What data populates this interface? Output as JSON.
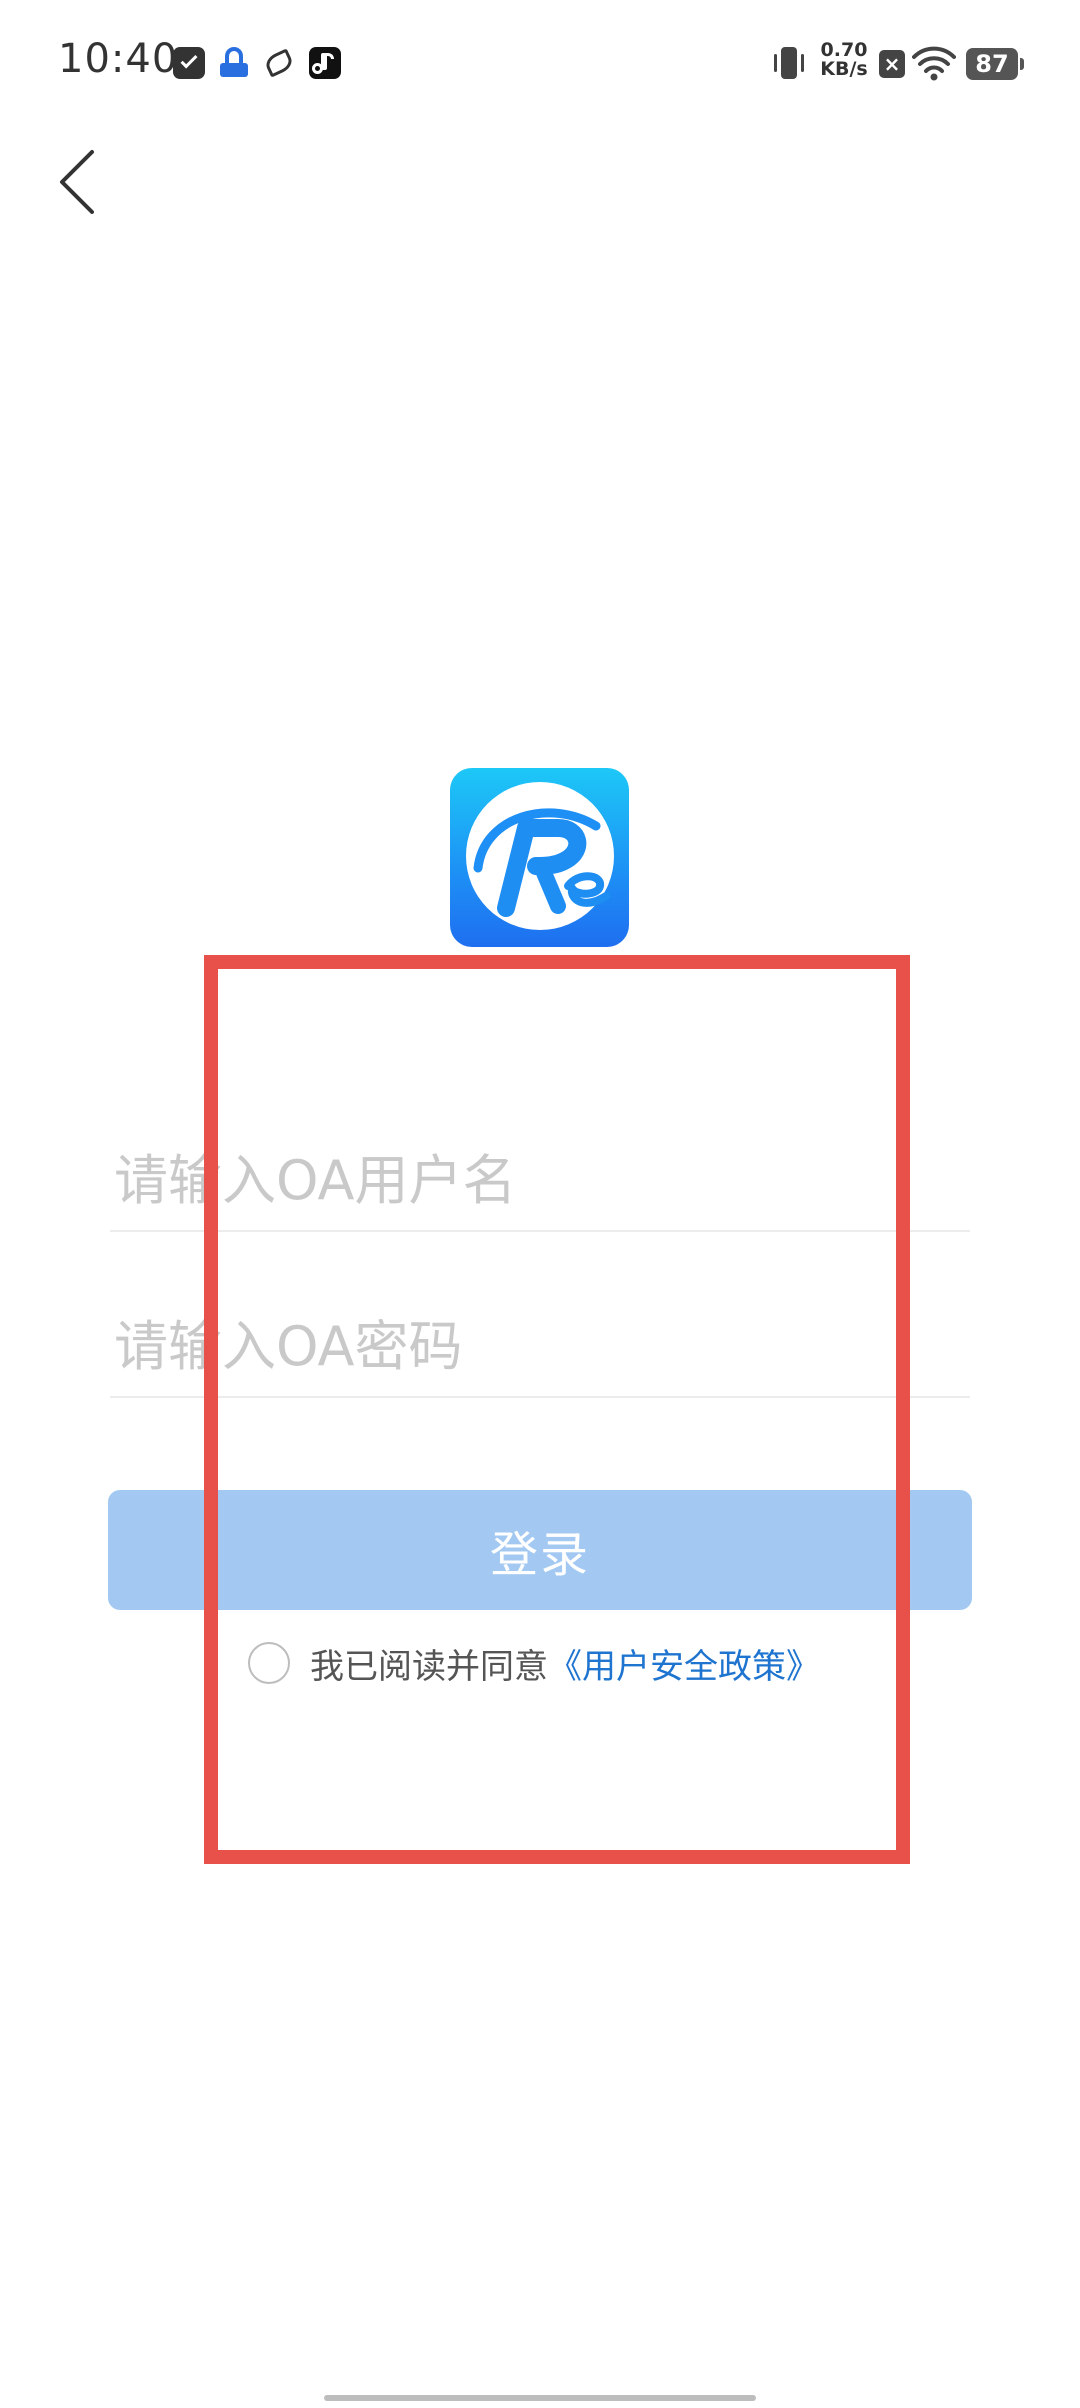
{
  "status_bar": {
    "time": "10:40",
    "net_speed_value": "0.70",
    "net_speed_unit": "KB/s",
    "notification_badge": "×",
    "battery_level": "87"
  },
  "icons": {
    "back": "chevron-left-icon",
    "logo": "re-app-logo"
  },
  "login_form": {
    "username_placeholder": "请输入OA用户名",
    "password_placeholder": "请输入OA密码",
    "login_label": "登录",
    "agreement_prefix": "我已阅读并同意",
    "policy_link": "《用户安全政策》",
    "agreement_checked": false
  },
  "colors": {
    "login_button": "#a3c9f2",
    "policy_link": "#1e74cf",
    "highlight_box": "#e8504a",
    "logo_top": "#1dc8f7",
    "logo_bottom": "#1f6ff0"
  }
}
